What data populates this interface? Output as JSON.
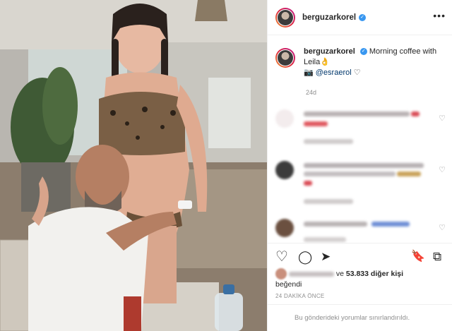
{
  "post": {
    "username": "berguzarkorel",
    "verified_glyph": "✓",
    "more_icon": "•••",
    "caption_username": "berguzarkorel",
    "caption_text": "Morning coffee with Leila",
    "caption_emoji": "👌",
    "caption_camera": "📷",
    "caption_mention": "@esraerol",
    "caption_heart": "♡",
    "age": "24d"
  },
  "comments": [
    {
      "avatar": "blurred",
      "heart_icon": "heart-icon"
    },
    {
      "avatar": "blurred",
      "heart_icon": "heart-icon"
    },
    {
      "avatar": "blurred",
      "heart_icon": "heart-icon"
    }
  ],
  "actions": {
    "like_icon": "♡",
    "comment_icon": "◯",
    "share_icon": "➤",
    "save_icon": "🔖",
    "igtv_icon": "⧉"
  },
  "likes": {
    "and_text": "ve",
    "count": "53.833",
    "others_text": "diğer kişi",
    "liked_text": "beğendi"
  },
  "timestamp": "24 DAKİKA ÖNCE",
  "footer_text": "Bu gönderideki yorumlar sınırlandırıldı.",
  "colors": {
    "verified": "#3897f0",
    "mention": "#00376b",
    "muted": "#8e8e8e",
    "border": "#efefef"
  }
}
